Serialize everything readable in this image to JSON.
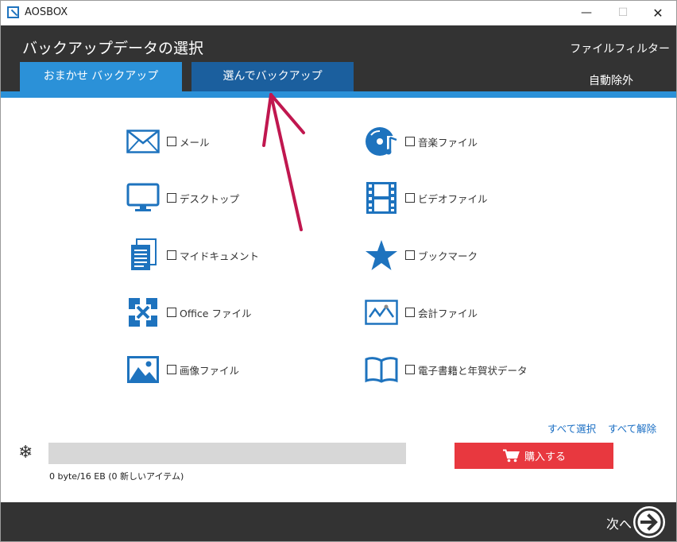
{
  "window": {
    "title": "AOSBOX",
    "minimize": "—",
    "maximize": "☐",
    "close": "✕"
  },
  "header": {
    "title": "バックアップデータの選択",
    "tabs": [
      {
        "label": "おまかせ バックアップ",
        "active": true
      },
      {
        "label": "選んでバックアップ",
        "active": false
      }
    ],
    "file_filter": "ファイルフィルター",
    "auto_exclude": "自動除外"
  },
  "categories": {
    "left": [
      {
        "label": "メール",
        "icon": "envelope-icon",
        "checked": false
      },
      {
        "label": "デスクトップ",
        "icon": "monitor-icon",
        "checked": false
      },
      {
        "label": "マイドキュメント",
        "icon": "documents-icon",
        "checked": false
      },
      {
        "label": "Office ファイル",
        "icon": "office-icon",
        "checked": false
      },
      {
        "label": "画像ファイル",
        "icon": "picture-icon",
        "checked": false
      }
    ],
    "right": [
      {
        "label": "音楽ファイル",
        "icon": "music-disc-icon",
        "checked": false
      },
      {
        "label": "ビデオファイル",
        "icon": "film-icon",
        "checked": false
      },
      {
        "label": "ブックマーク",
        "icon": "star-icon",
        "checked": false
      },
      {
        "label": "会計ファイル",
        "icon": "chart-icon",
        "checked": false
      },
      {
        "label": "電子書籍と年賀状データ",
        "icon": "book-icon",
        "checked": false
      }
    ]
  },
  "actions": {
    "select_all": "すべて選択",
    "deselect_all": "すべて解除"
  },
  "storage": {
    "status": "0 byte/16 EB (0 新しいアイテム)",
    "progress": 0
  },
  "purchase": {
    "label": "購入する"
  },
  "footer": {
    "next": "次へ"
  },
  "colors": {
    "accent": "#2b91d8",
    "tab_inactive": "#1b5f9e",
    "dark": "#333333",
    "buy": "#e8383f",
    "annotation_arrow": "#c0174f"
  }
}
